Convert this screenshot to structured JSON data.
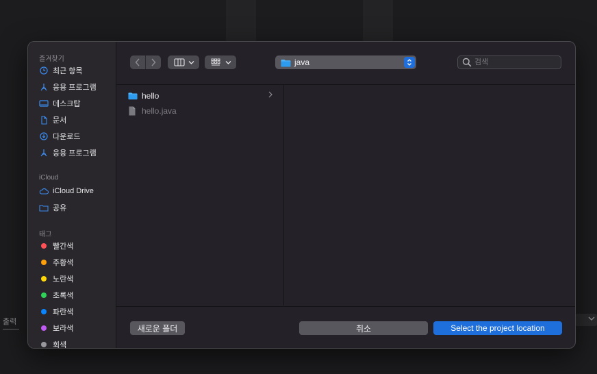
{
  "background": {
    "bottom_label": "출력"
  },
  "sidebar": {
    "favorites_header": "즐겨찾기",
    "favorites": [
      {
        "label": "최근 항목",
        "icon": "clock-icon"
      },
      {
        "label": "응용 프로그램",
        "icon": "applications-icon"
      },
      {
        "label": "데스크탑",
        "icon": "desktop-icon"
      },
      {
        "label": "문서",
        "icon": "document-icon"
      },
      {
        "label": "다운로드",
        "icon": "download-icon"
      },
      {
        "label": "응용 프로그램",
        "icon": "applications-icon"
      }
    ],
    "icloud_header": "iCloud",
    "icloud": [
      {
        "label": "iCloud Drive",
        "icon": "cloud-icon"
      },
      {
        "label": "공유",
        "icon": "shared-folder-icon"
      }
    ],
    "tags_header": "태그",
    "tags": [
      {
        "label": "빨간색",
        "color": "#ff5257"
      },
      {
        "label": "주황색",
        "color": "#ff9f0a"
      },
      {
        "label": "노란색",
        "color": "#ffd60a"
      },
      {
        "label": "초록색",
        "color": "#30d158"
      },
      {
        "label": "파란색",
        "color": "#0a84ff"
      },
      {
        "label": "보라색",
        "color": "#bf5af2"
      },
      {
        "label": "회색",
        "color": "#98989d"
      }
    ]
  },
  "toolbar": {
    "current_folder": "java",
    "search_placeholder": "검색"
  },
  "browser": {
    "files": [
      {
        "name": "hello",
        "type": "folder"
      },
      {
        "name": "hello.java",
        "type": "file"
      }
    ]
  },
  "footer": {
    "new_folder_label": "새로운 폴더",
    "cancel_label": "취소",
    "confirm_label": "Select the project location"
  },
  "colors": {
    "accent": "#1e6fdc",
    "sidebar_icon": "#3b8cf0"
  }
}
